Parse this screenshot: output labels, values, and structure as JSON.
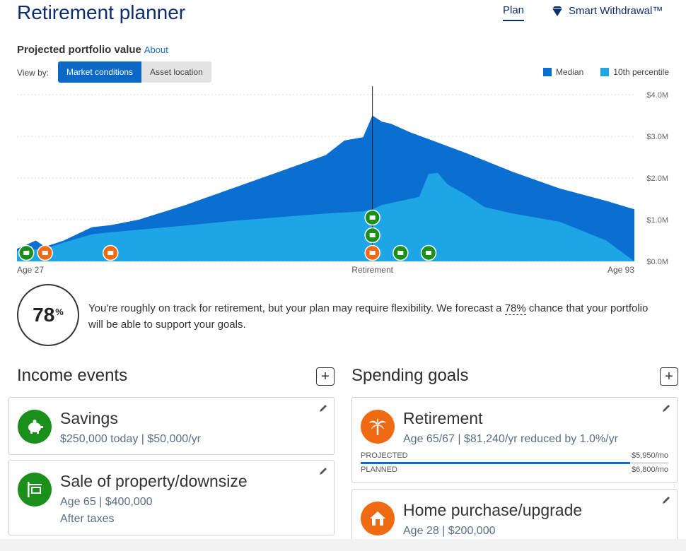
{
  "header": {
    "title": "Retirement planner",
    "nav_plan": "Plan",
    "nav_smart_withdrawal": "Smart Withdrawal™"
  },
  "chart_section": {
    "title": "Projected portfolio value",
    "about_link": "About",
    "view_by_label": "View by:",
    "toggle_market": "Market conditions",
    "toggle_asset": "Asset location"
  },
  "legend": {
    "median": "Median",
    "tenth": "10th percentile"
  },
  "colors": {
    "median": "#0b6fd1",
    "tenth": "#1ea5e6",
    "green_event": "#1a8f1a",
    "orange_event": "#f06a14",
    "title_blue": "#0b2e6f"
  },
  "chart_data": {
    "type": "area",
    "x_start_label": "Age 27",
    "x_mid_label": "Retirement",
    "x_end_label": "Age 93",
    "x_range": [
      27,
      93
    ],
    "retirement_age": 65,
    "y_ticks": [
      "$0.0M",
      "$1.0M",
      "$2.0M",
      "$3.0M",
      "$4.0M"
    ],
    "ylim": [
      0,
      4.0
    ],
    "grid": true,
    "legend_position": "top-right",
    "series": [
      {
        "name": "Median",
        "points": [
          [
            27,
            0.3
          ],
          [
            29,
            0.5
          ],
          [
            30,
            0.35
          ],
          [
            32,
            0.5
          ],
          [
            35,
            0.82
          ],
          [
            37,
            0.87
          ],
          [
            40,
            1.0
          ],
          [
            45,
            1.35
          ],
          [
            50,
            1.75
          ],
          [
            55,
            2.15
          ],
          [
            60,
            2.55
          ],
          [
            62,
            2.9
          ],
          [
            64,
            2.98
          ],
          [
            65,
            3.5
          ],
          [
            66,
            3.35
          ],
          [
            67,
            3.3
          ],
          [
            69,
            3.1
          ],
          [
            72,
            2.85
          ],
          [
            75,
            2.6
          ],
          [
            80,
            2.15
          ],
          [
            85,
            1.75
          ],
          [
            90,
            1.45
          ],
          [
            93,
            1.25
          ]
        ]
      },
      {
        "name": "10th percentile",
        "points": [
          [
            27,
            0.25
          ],
          [
            30,
            0.3
          ],
          [
            32,
            0.45
          ],
          [
            35,
            0.65
          ],
          [
            37,
            0.7
          ],
          [
            40,
            0.76
          ],
          [
            45,
            0.86
          ],
          [
            50,
            0.97
          ],
          [
            55,
            1.06
          ],
          [
            60,
            1.15
          ],
          [
            64,
            1.2
          ],
          [
            65,
            1.25
          ],
          [
            66,
            1.35
          ],
          [
            70,
            1.55
          ],
          [
            71,
            2.1
          ],
          [
            72,
            2.12
          ],
          [
            73,
            1.85
          ],
          [
            75,
            1.6
          ],
          [
            77,
            1.3
          ],
          [
            80,
            1.15
          ],
          [
            85,
            0.95
          ],
          [
            90,
            0.5
          ],
          [
            93,
            0.0
          ]
        ]
      }
    ],
    "event_markers": [
      {
        "age": 28,
        "row": 0,
        "kind": "income",
        "icon": "piggy-bank-icon"
      },
      {
        "age": 30,
        "row": 0,
        "kind": "goal",
        "icon": "house-icon"
      },
      {
        "age": 37,
        "row": 0,
        "kind": "goal",
        "icon": "graduation-cap-icon"
      },
      {
        "age": 65,
        "row": 2,
        "kind": "income",
        "icon": "sign-post-icon"
      },
      {
        "age": 65,
        "row": 1,
        "kind": "income",
        "icon": "cash-icon"
      },
      {
        "age": 65,
        "row": 0,
        "kind": "goal",
        "icon": "palm-tree-icon"
      },
      {
        "age": 68,
        "row": 0,
        "kind": "income",
        "icon": "cash-icon"
      },
      {
        "age": 71,
        "row": 0,
        "kind": "income",
        "icon": "money-bill-icon"
      }
    ]
  },
  "probability": {
    "value": "78",
    "suffix": "%",
    "text_before": "You're roughly on track for retirement, but your plan may require flexibility. We forecast a ",
    "text_highlight": "78%",
    "text_after": " chance that your portfolio will be able to support your goals."
  },
  "income": {
    "title": "Income events",
    "add": "+",
    "cards": [
      {
        "title": "Savings",
        "line1": "$250,000 today | $50,000/yr",
        "line2": "",
        "icon": "piggy-bank-icon"
      },
      {
        "title": "Sale of property/downsize",
        "line1": "Age 65 | $400,000",
        "line2": "After taxes",
        "icon": "sign-post-icon"
      }
    ]
  },
  "spending": {
    "title": "Spending goals",
    "add": "+",
    "cards": [
      {
        "title": "Retirement",
        "line1": "Age 65/67 | $81,240/yr reduced by 1.0%/yr",
        "icon": "palm-tree-icon",
        "projected_label": "PROJECTED",
        "projected_value": "$5,950/mo",
        "projected_fraction": 0.875,
        "planned_label": "PLANNED",
        "planned_value": "$6,800/mo"
      },
      {
        "title": "Home purchase/upgrade",
        "line1": "Age 28 | $200,000",
        "icon": "house-icon"
      }
    ]
  }
}
